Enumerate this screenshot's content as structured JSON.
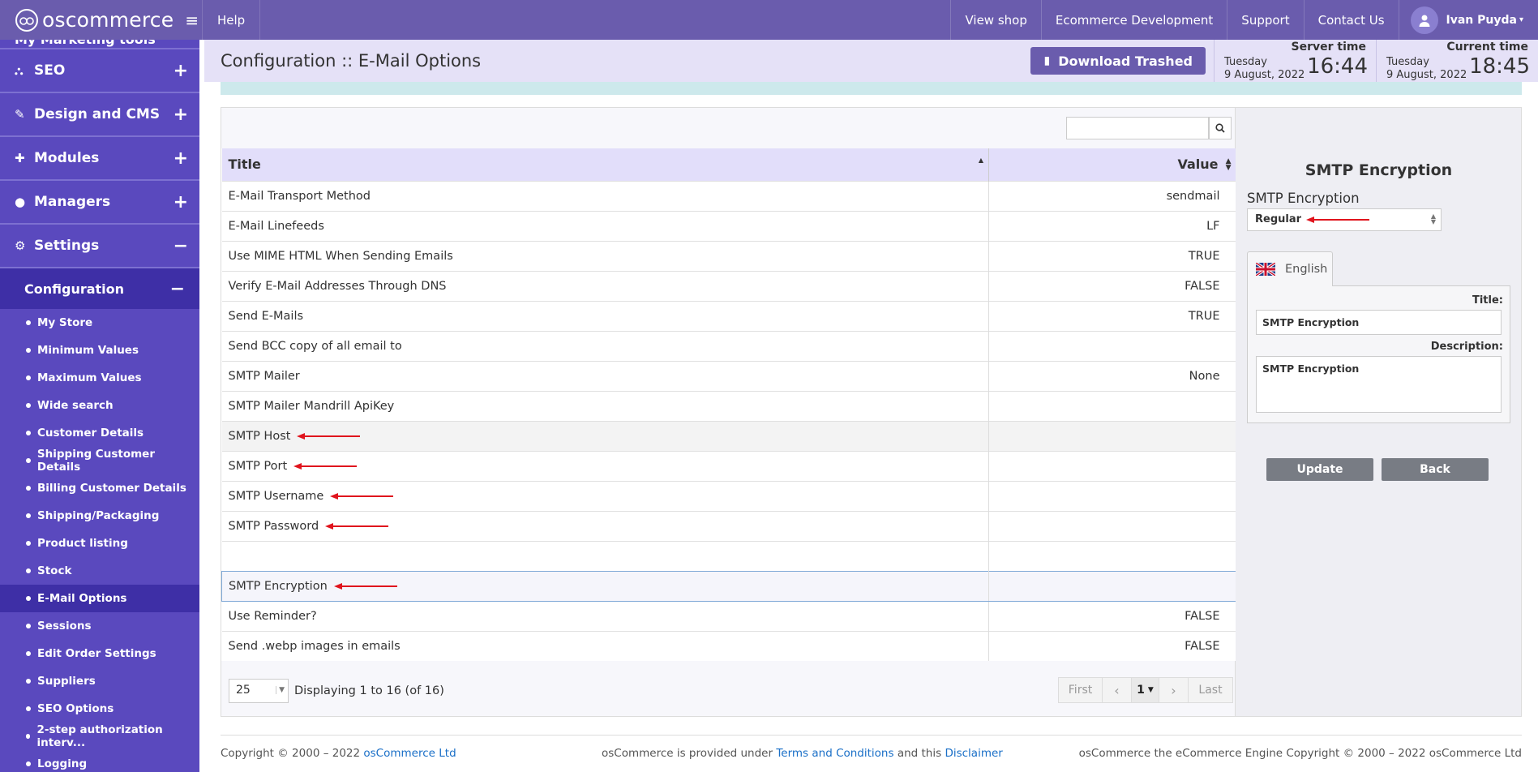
{
  "topbar": {
    "logo_text": "oscommerce",
    "help": "Help",
    "nav": [
      "View shop",
      "Ecommerce Development",
      "Support",
      "Contact Us"
    ],
    "user_name": "Ivan Puyda",
    "user_caret": "▾"
  },
  "sidebar": {
    "partial_top": "My Marketing tools",
    "main_items": [
      {
        "label": "SEO",
        "toggle": "+"
      },
      {
        "label": "Design and CMS",
        "toggle": "+"
      },
      {
        "label": "Modules",
        "toggle": "+"
      },
      {
        "label": "Managers",
        "toggle": "+"
      },
      {
        "label": "Settings",
        "toggle": "−"
      }
    ],
    "sub_header": {
      "label": "Configuration",
      "toggle": "−"
    },
    "sub_items": [
      "My Store",
      "Minimum Values",
      "Maximum Values",
      "Wide search",
      "Customer Details",
      "Shipping Customer Details",
      "Billing Customer Details",
      "Shipping/Packaging",
      "Product listing",
      "Stock",
      "E-Mail Options",
      "Sessions",
      "Edit Order Settings",
      "Suppliers",
      "SEO Options",
      "2-step authorization interv...",
      "Logging"
    ],
    "active_sub_item": "E-Mail Options"
  },
  "header": {
    "title": "Configuration :: E-Mail Options",
    "download_button": "Download Trashed",
    "server_time": {
      "label": "Server time",
      "day": "Tuesday",
      "date": "9 August, 2022",
      "time": "16:44"
    },
    "current_time": {
      "label": "Current time",
      "day": "Tuesday",
      "date": "9 August, 2022",
      "time": "18:45"
    }
  },
  "table": {
    "search_placeholder": "",
    "columns": {
      "title": "Title",
      "value": "Value"
    },
    "rows": [
      {
        "title": "E-Mail Transport Method",
        "value": "sendmail"
      },
      {
        "title": "E-Mail Linefeeds",
        "value": "LF"
      },
      {
        "title": "Use MIME HTML When Sending Emails",
        "value": "TRUE"
      },
      {
        "title": "Verify E-Mail Addresses Through DNS",
        "value": "FALSE"
      },
      {
        "title": "Send E-Mails",
        "value": "TRUE"
      },
      {
        "title": "Send BCC copy of all email to",
        "value": ""
      },
      {
        "title": "SMTP Mailer",
        "value": "None"
      },
      {
        "title": "SMTP Mailer Mandrill ApiKey",
        "value": ""
      },
      {
        "title": "SMTP Host",
        "value": ""
      },
      {
        "title": "SMTP Port",
        "value": ""
      },
      {
        "title": "SMTP Username",
        "value": ""
      },
      {
        "title": "SMTP Password",
        "value": ""
      },
      {
        "title": "",
        "value": ""
      },
      {
        "title": "SMTP Encryption",
        "value": ""
      },
      {
        "title": "Use Reminder?",
        "value": "FALSE"
      },
      {
        "title": "Send .webp images in emails",
        "value": "FALSE"
      }
    ],
    "per_page": "25",
    "displaying": "Displaying 1 to 16 (of 16)",
    "pager": {
      "first": "First",
      "page": "1",
      "last": "Last"
    }
  },
  "edit": {
    "heading": "SMTP Encryption",
    "field_label": "SMTP Encryption",
    "select_value": "Regular",
    "language_tab": "English",
    "title_label": "Title:",
    "title_value": "SMTP Encryption",
    "description_label": "Description:",
    "description_value": "SMTP Encryption",
    "update_button": "Update",
    "back_button": "Back"
  },
  "footer": {
    "left_text": "Copyright © 2000 – 2022",
    "left_link": "osCommerce Ltd",
    "center_text_1": "osCommerce is provided under",
    "center_link_1": "Terms and Conditions",
    "center_text_2": "and this",
    "center_link_2": "Disclaimer",
    "right_text": "osCommerce the eCommerce Engine Copyright © 2000 – 2022 osCommerce Ltd"
  },
  "colors": {
    "topbar": "#6a5cad",
    "sidebar": "#5a49be",
    "sidebar_active": "#3e2fa6",
    "arrow": "#e0141d"
  }
}
